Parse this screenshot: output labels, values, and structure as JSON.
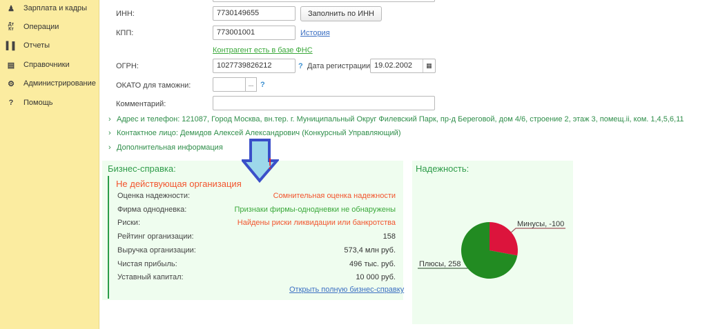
{
  "sidebar": {
    "items": [
      {
        "label": "Зарплата и кадры",
        "icon": "person-icon"
      },
      {
        "label": "Операции",
        "icon": "dt-kt-icon"
      },
      {
        "label": "Отчеты",
        "icon": "bar-chart-icon"
      },
      {
        "label": "Справочники",
        "icon": "books-icon"
      },
      {
        "label": "Администрирование",
        "icon": "gear-icon"
      },
      {
        "label": "Помощь",
        "icon": "question-icon"
      }
    ]
  },
  "form": {
    "inn_label": "ИНН:",
    "inn_value": "7730149655",
    "fill_by_inn": "Заполнить по ИНН",
    "kpp_label": "КПП:",
    "kpp_value": "773001001",
    "history_link": "История",
    "fns_link": "Контрагент есть в базе ФНС",
    "ogrn_label": "ОГРН:",
    "ogrn_value": "1027739826212",
    "help": "?",
    "reg_date_label": "Дата регистрации:",
    "reg_date_value": "19.02.2002",
    "okato_label": "ОКАТО для таможни:",
    "okato_value": "",
    "select_btn": "...",
    "comment_label": "Комментарий:",
    "comment_value": ""
  },
  "sections": [
    "Адрес и телефон: 121087, Город Москва, вн.тер. г. Муниципальный Округ Филевский Парк, пр-д Береговой, дом 4/6, строение 2, этаж 3, помещ.ii, ком. 1,4,5,6,11",
    "Контактное лицо: Демидов Алексей Александрович (Конкурсный Управляющий)",
    "Дополнительная информация"
  ],
  "annotation": {
    "mark": "!",
    "colors": {
      "fill": "#9dd8ea",
      "stroke": "#3a4fc9",
      "mark": "#e8202a"
    }
  },
  "business": {
    "title": "Бизнес-справка:",
    "status": "Не действующая организация",
    "rows": [
      {
        "key": "Оценка надежности:",
        "value": "Сомнительная оценка надежности",
        "tone": "red"
      },
      {
        "key": "Фирма однодневка:",
        "value": "Признаки фирмы-однодневки не обнаружены",
        "tone": "grn"
      },
      {
        "key": "Риски:",
        "value": "Найдены риски ликвидации или банкротства",
        "tone": "red"
      },
      {
        "key": "Рейтинг организации:",
        "value": "158",
        "tone": ""
      },
      {
        "key": "Выручка организации:",
        "value": "573,4 млн руб.",
        "tone": ""
      },
      {
        "key": "Чистая прибыль:",
        "value": "496 тыс. руб.",
        "tone": ""
      },
      {
        "key": "Уставный капитал:",
        "value": "10 000 руб.",
        "tone": ""
      }
    ],
    "open_link": "Открыть полную бизнес-справку"
  },
  "reliability": {
    "title": "Надежность:"
  },
  "chart_data": {
    "type": "pie",
    "title": "Надежность:",
    "slices": [
      {
        "name": "Минусы",
        "value": -100,
        "label": "Минусы, -100",
        "color": "#dc143c"
      },
      {
        "name": "Плюсы",
        "value": 258,
        "label": "Плюсы, 258",
        "color": "#228b22"
      }
    ]
  }
}
